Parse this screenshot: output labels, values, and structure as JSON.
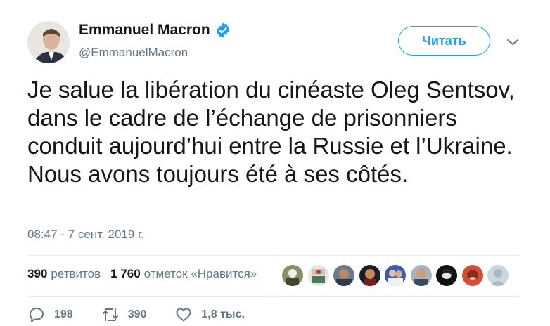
{
  "author": {
    "name": "Emmanuel Macron",
    "handle": "@EmmanuelMacron",
    "verified": true
  },
  "follow_button": {
    "label": "Читать"
  },
  "tweet": {
    "text": "Je salue la libération du cinéaste Oleg Sentsov, dans le cadre de l’échange de prisonniers conduit aujourd’hui entre la Russie et l’Ukraine. Nous avons toujours été à ses côtés.",
    "timestamp": "08:47 - 7 сент. 2019 г."
  },
  "stats": {
    "retweets_count": "390",
    "retweets_label": "ретвитов",
    "likes_count": "1 760",
    "likes_label": "отметок «Нравится»"
  },
  "likers": [
    "liker-1",
    "liker-2",
    "liker-3",
    "liker-4",
    "liker-5",
    "liker-6",
    "liker-7",
    "liker-8",
    "liker-9"
  ],
  "actions": {
    "reply_count": "198",
    "retweet_count": "390",
    "like_count": "1,8 тыс."
  },
  "colors": {
    "accent": "#1da1f2",
    "muted": "#657786",
    "text": "#14171a",
    "divider": "#e6ecf0"
  },
  "icons": [
    "verified-icon",
    "chevron-down-icon",
    "reply-icon",
    "retweet-icon",
    "heart-icon"
  ]
}
